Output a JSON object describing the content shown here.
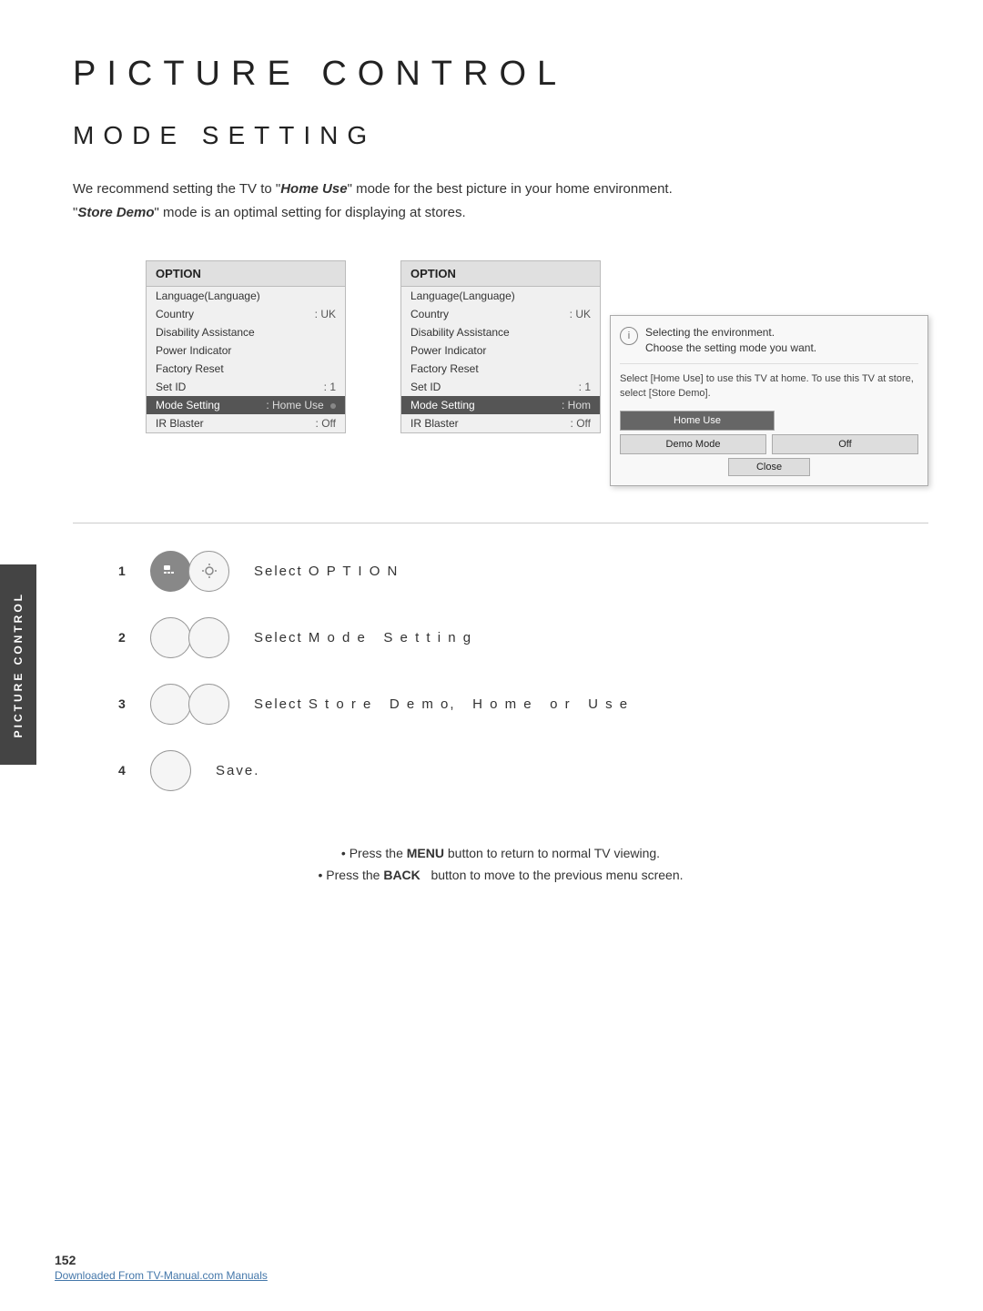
{
  "page": {
    "title": "PICTURE CONTROL",
    "section": "MODE SETTING",
    "intro": {
      "line1_prefix": "We recommend setting the TV to \"",
      "highlight1": "Home Use",
      "line1_suffix": "\" mode for the best picture in your home environment.",
      "line2_prefix": "\"",
      "highlight2": "Store Demo",
      "line2_suffix": "\" mode is an optimal setting for displaying at stores."
    }
  },
  "menu_left": {
    "title": "OPTION",
    "rows": [
      {
        "label": "Language(Language)",
        "value": ""
      },
      {
        "label": "Country",
        "value": ": UK"
      },
      {
        "label": "Disability Assistance",
        "value": ""
      },
      {
        "label": "Power Indicator",
        "value": ""
      },
      {
        "label": "Factory Reset",
        "value": ""
      },
      {
        "label": "Set ID",
        "value": ": 1"
      },
      {
        "label": "Mode Setting",
        "value": ": Home Use",
        "selected": true,
        "dot": true
      },
      {
        "label": "IR Blaster",
        "value": ": Off"
      }
    ]
  },
  "menu_right": {
    "title": "OPTION",
    "rows": [
      {
        "label": "Language(Language)",
        "value": ""
      },
      {
        "label": "Country",
        "value": ": UK"
      },
      {
        "label": "Disability Assistance",
        "value": ""
      },
      {
        "label": "Power Indicator",
        "value": ""
      },
      {
        "label": "Factory Reset",
        "value": ""
      },
      {
        "label": "Set ID",
        "value": ": 1"
      },
      {
        "label": "Mode Setting",
        "value": ": Hom",
        "selected": true
      },
      {
        "label": "IR Blaster",
        "value": ": Off"
      }
    ]
  },
  "popup": {
    "icon": "i",
    "header1": "Selecting the environment.",
    "header2": "Choose the setting mode you want.",
    "description": "Select [Home Use] to use this TV at home. To use this TV at store, select [Store Demo].",
    "btn_home": "Home Use",
    "btn_demo": "Demo Mode",
    "btn_demo_value": "Off",
    "btn_close": "Close"
  },
  "steps": [
    {
      "number": "1",
      "text": "Select OPTION",
      "circles": 2
    },
    {
      "number": "2",
      "text": "Select Mode Setting",
      "circles": 2
    },
    {
      "number": "3",
      "text": "Select Store Demo, Home or Use",
      "circles": 2
    },
    {
      "number": "4",
      "text": "Save.",
      "circles": 1
    }
  ],
  "notes": [
    "• Press the MENU button to return to normal TV viewing.",
    "• Press the BACK button to move to the previous menu screen."
  ],
  "side_label": "PICTURE CONTROL",
  "page_number": "152",
  "footer_link": "Downloaded From TV-Manual.com Manuals"
}
